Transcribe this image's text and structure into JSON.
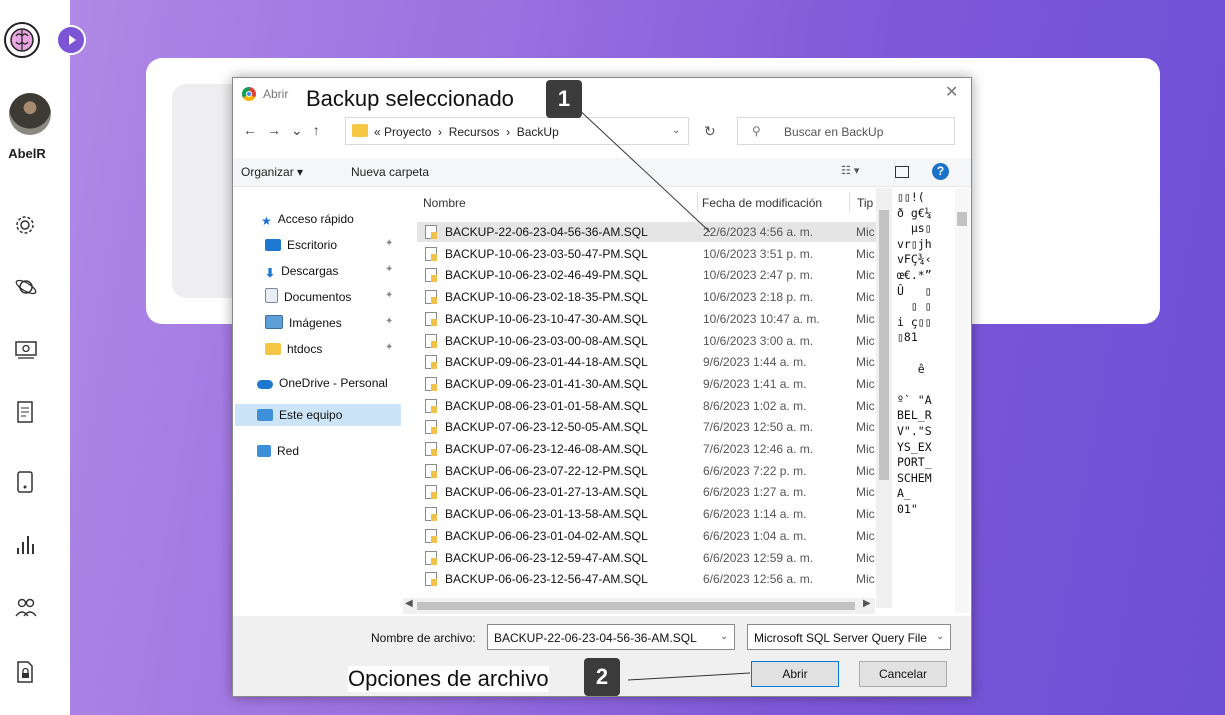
{
  "user": {
    "name": "AbelR"
  },
  "sidebar": {
    "icons": [
      "gear-icon",
      "planet-icon",
      "money-icon",
      "receipt-icon",
      "phone-icon",
      "chart-icon",
      "users-icon",
      "document-lock-icon"
    ]
  },
  "dialog": {
    "title": "Abrir",
    "address": {
      "prefix": "«",
      "path": "Proyecto  ›  Recursos  ›  BackUp"
    },
    "search_placeholder": "Buscar en BackUp",
    "toolbar": {
      "organize": "Organizar ▾",
      "new_folder": "Nueva carpeta"
    },
    "nav": [
      {
        "label": "Acceso rápido"
      },
      {
        "label": "Escritorio"
      },
      {
        "label": "Descargas"
      },
      {
        "label": "Documentos"
      },
      {
        "label": "Imágenes"
      },
      {
        "label": "htdocs"
      },
      {
        "label": "OneDrive - Personal"
      },
      {
        "label": "Este equipo"
      },
      {
        "label": "Red"
      }
    ],
    "columns": {
      "name": "Nombre",
      "date": "Fecha de modificación",
      "type": "Tip"
    },
    "files": [
      {
        "name": "BACKUP-22-06-23-04-56-36-AM.SQL",
        "date": "22/6/2023 4:56 a. m.",
        "type": "Mic"
      },
      {
        "name": "BACKUP-10-06-23-03-50-47-PM.SQL",
        "date": "10/6/2023 3:51 p. m.",
        "type": "Mic"
      },
      {
        "name": "BACKUP-10-06-23-02-46-49-PM.SQL",
        "date": "10/6/2023 2:47 p. m.",
        "type": "Mic"
      },
      {
        "name": "BACKUP-10-06-23-02-18-35-PM.SQL",
        "date": "10/6/2023 2:18 p. m.",
        "type": "Mic"
      },
      {
        "name": "BACKUP-10-06-23-10-47-30-AM.SQL",
        "date": "10/6/2023 10:47 a. m.",
        "type": "Mic"
      },
      {
        "name": "BACKUP-10-06-23-03-00-08-AM.SQL",
        "date": "10/6/2023 3:00 a. m.",
        "type": "Mic"
      },
      {
        "name": "BACKUP-09-06-23-01-44-18-AM.SQL",
        "date": "9/6/2023 1:44 a. m.",
        "type": "Mic"
      },
      {
        "name": "BACKUP-09-06-23-01-41-30-AM.SQL",
        "date": "9/6/2023 1:41 a. m.",
        "type": "Mic"
      },
      {
        "name": "BACKUP-08-06-23-01-01-58-AM.SQL",
        "date": "8/6/2023 1:02 a. m.",
        "type": "Mic"
      },
      {
        "name": "BACKUP-07-06-23-12-50-05-AM.SQL",
        "date": "7/6/2023 12:50 a. m.",
        "type": "Mic"
      },
      {
        "name": "BACKUP-07-06-23-12-46-08-AM.SQL",
        "date": "7/6/2023 12:46 a. m.",
        "type": "Mic"
      },
      {
        "name": "BACKUP-06-06-23-07-22-12-PM.SQL",
        "date": "6/6/2023 7:22 p. m.",
        "type": "Mic"
      },
      {
        "name": "BACKUP-06-06-23-01-27-13-AM.SQL",
        "date": "6/6/2023 1:27 a. m.",
        "type": "Mic"
      },
      {
        "name": "BACKUP-06-06-23-01-13-58-AM.SQL",
        "date": "6/6/2023 1:14 a. m.",
        "type": "Mic"
      },
      {
        "name": "BACKUP-06-06-23-01-04-02-AM.SQL",
        "date": "6/6/2023 1:04 a. m.",
        "type": "Mic"
      },
      {
        "name": "BACKUP-06-06-23-12-59-47-AM.SQL",
        "date": "6/6/2023 12:59 a. m.",
        "type": "Mic"
      },
      {
        "name": "BACKUP-06-06-23-12-56-47-AM.SQL",
        "date": "6/6/2023 12:56 a. m.",
        "type": "Mic"
      }
    ],
    "selected_index": 0,
    "preview_lines": [
      "▯▯!(",
      "ð g€¼",
      "  µs▯",
      "vr▯jh",
      "vFÇ¾‹",
      "œ€.*”",
      "Û   ▯",
      "  ▯ ▯",
      "i ç▯▯",
      "▯81",
      "",
      "   ê",
      "",
      "º` \"A",
      "BEL_R",
      "V\".\"S",
      "YS_EX",
      "PORT_",
      "SCHEM",
      "A_",
      "01\""
    ],
    "file_name_label": "Nombre de archivo:",
    "file_name_value": "BACKUP-22-06-23-04-56-36-AM.SQL",
    "file_type": "Microsoft SQL Server Query File",
    "open_button": "Abrir",
    "cancel_button": "Cancelar"
  },
  "annotations": [
    {
      "number": "1",
      "text": "Backup seleccionado"
    },
    {
      "number": "2",
      "text": "Opciones de archivo"
    }
  ]
}
